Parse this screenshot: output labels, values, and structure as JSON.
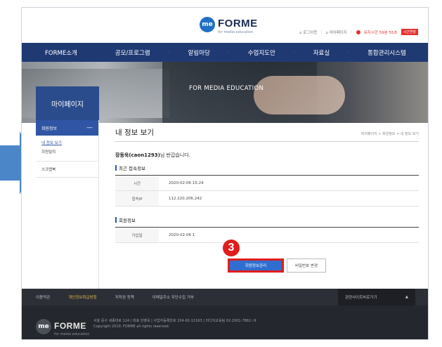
{
  "header": {
    "logo_mark": "me",
    "logo_text": "FORME",
    "logo_sub": "for media education",
    "util": {
      "logout": "⌂ 로그아웃",
      "mypage": "⌂ 마이페이지",
      "session_time": "유지시간 59분 55초",
      "extend": "시간연장"
    }
  },
  "nav": {
    "items": [
      "FORME소개",
      "공모/프로그램",
      "알림마당",
      "수업지도안",
      "자료실",
      "통합관리시스템"
    ]
  },
  "hero": {
    "title": "FOR MEDIA EDUCATION",
    "mypage": "마이페이지"
  },
  "sidebar": {
    "head": "회원정보",
    "minus": "—",
    "sub_items": [
      "내 정보 보기",
      "회원탈퇴"
    ],
    "scrap": "스크랩북"
  },
  "main": {
    "title": "내 정보 보기",
    "breadcrumb": "마이페이지 > 회원정보 > 내 정보 보기",
    "greeting_name": "장동욱(caon1293)",
    "greeting_rest": "님 반갑습니다.",
    "recent_title": "최근 접속정보",
    "recent_rows": [
      {
        "label": "시간",
        "value": "2020-02-06 15:24"
      },
      {
        "label": "접속IP",
        "value": "112.220.206.242"
      }
    ],
    "member_title": "회원정보",
    "member_rows": [
      {
        "label": "가입일",
        "value": "2020-02-06 1"
      }
    ],
    "btn_manage": "회원정보관리",
    "btn_password": "비밀번호 변경",
    "step": "3"
  },
  "footer": {
    "links": [
      "이용약관",
      "개인정보취급방침",
      "저작권 정책",
      "이메일주소 무단수집 거부"
    ],
    "family_site": "관련사이트바로가기",
    "family_arrow": "▲",
    "address_line1": "서울 중구 세종대로 124 | 대표 민병욱 | 사업자등록번호 104-82-11163 | 미디어교육팀 02-2001-7861~9",
    "address_line2": "Copyright 2019. FORME all rights reserved."
  },
  "colors": {
    "nav_bg": "#1f3a73",
    "accent": "#2f55a4",
    "highlight_red": "#e11c1c",
    "arrow": "#4a86c8"
  }
}
